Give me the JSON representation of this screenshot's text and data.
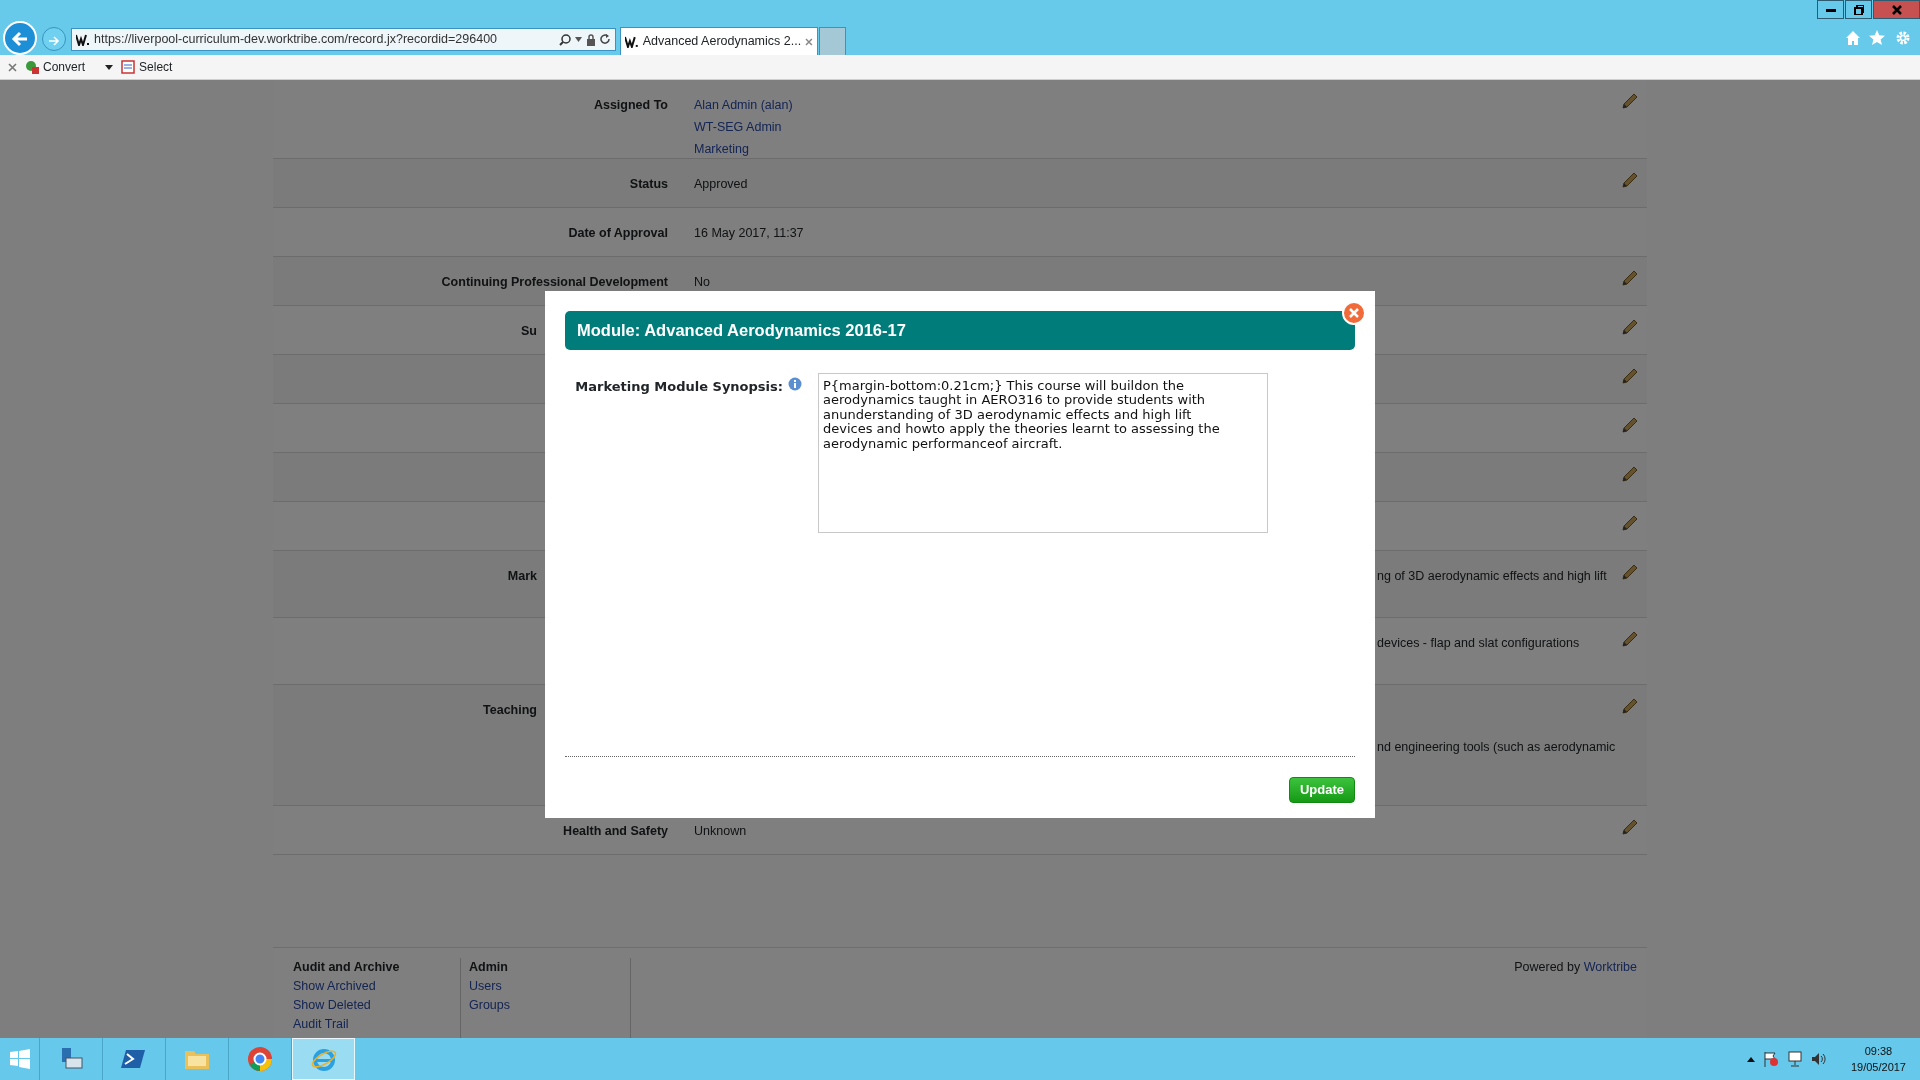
{
  "browser": {
    "url": "https://liverpool-curriculum-dev.worktribe.com/record.jx?recordid=296400",
    "tabs": [
      {
        "title": "Advanced Aerodynamics 2...",
        "selected": true
      }
    ],
    "toolbar": [
      {
        "label": "Convert",
        "kind": "dropdown"
      },
      {
        "label": "Select",
        "kind": "plain"
      }
    ]
  },
  "record": {
    "rows": [
      {
        "kind": "plain",
        "label": "Assigned To",
        "values": [
          {
            "text": "Alan Admin (alan)",
            "link": true
          },
          {
            "text": "WT-SEG Admin",
            "link": true
          },
          {
            "text": "Marketing",
            "link": true
          }
        ],
        "editable": true
      },
      {
        "kind": "plain",
        "label": "Status",
        "values": [
          {
            "text": "Approved",
            "link": false
          }
        ],
        "editable": true
      },
      {
        "kind": "plain",
        "label": "Date of Approval",
        "values": [
          {
            "text": "16 May 2017, 11:37",
            "link": false
          }
        ],
        "editable": false
      },
      {
        "kind": "plain",
        "label": "Continuing Professional Development",
        "values": [
          {
            "text": "No",
            "link": false
          }
        ],
        "editable": true
      },
      {
        "kind": "covered",
        "label": "Su",
        "values": [],
        "editable": true
      },
      {
        "kind": "covered",
        "values": [],
        "editable": true
      },
      {
        "kind": "covered",
        "values": [],
        "editable": true
      },
      {
        "kind": "covered",
        "values": [],
        "editable": true
      },
      {
        "kind": "covered",
        "values": [],
        "editable": true
      },
      {
        "kind": "covered-wide",
        "label": "Mark",
        "values": [
          {
            "text": "ng of 3D aerodynamic effects and high lift",
            "link": false
          }
        ],
        "editable": true
      },
      {
        "kind": "covered-wide",
        "values": [
          {
            "text": "devices - flap and slat configurations",
            "link": false
          }
        ],
        "editable": true
      },
      {
        "kind": "covered-tall",
        "label": "Teaching",
        "values": [
          {
            "text": "nd engineering tools (such as aerodynamic",
            "link": false
          }
        ],
        "editable": true
      },
      {
        "kind": "plain",
        "label": "Health and Safety",
        "values": [
          {
            "text": "Unknown",
            "link": false
          }
        ],
        "editable": true
      }
    ]
  },
  "footer": {
    "columns": [
      {
        "heading": "Audit and Archive",
        "links": [
          "Show Archived",
          "Show Deleted",
          "Audit Trail"
        ]
      },
      {
        "heading": "Admin",
        "links": [
          "Users",
          "Groups"
        ]
      }
    ],
    "powered_by": "Powered by",
    "powered_by_link": "Worktribe"
  },
  "modal": {
    "title": "Module: Advanced Aerodynamics 2016-17",
    "field_label": "Marketing Module Synopsis:",
    "field_value": "P{margin-bottom:0.21cm;} This course will buildon the aerodynamics taught in AERO316 to provide students with anunderstanding of 3D aerodynamic effects and high lift devices and howto apply the theories learnt to assessing the aerodynamic performanceof aircraft.",
    "button": "Update"
  },
  "taskbar": {
    "apps": [
      {
        "kind": "server-manager",
        "selected": false
      },
      {
        "kind": "powershell",
        "selected": false
      },
      {
        "kind": "explorer",
        "selected": false
      },
      {
        "kind": "chrome",
        "selected": false
      },
      {
        "kind": "ie",
        "selected": true
      }
    ],
    "time": "09:38",
    "date": "19/05/2017"
  }
}
